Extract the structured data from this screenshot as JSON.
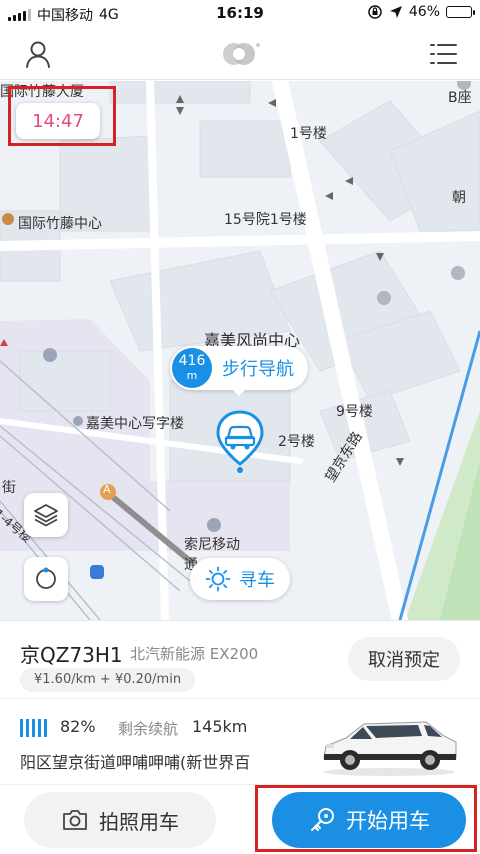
{
  "status_bar": {
    "carrier": "中国移动",
    "network": "4G",
    "time": "16:19",
    "battery": "46%",
    "battery_level": 0.46
  },
  "nav": {
    "user_icon": "user-icon",
    "logo_icon": "app-logo-icon",
    "menu_icon": "list-menu-icon"
  },
  "map": {
    "countdown": "14:47",
    "labels": {
      "top_cut": "国际竹藤大厦",
      "b_building": "B座",
      "building_1": "1号楼",
      "chao": "朝",
      "bamboo_center": "国际竹藤中心",
      "courtyard_15": "15号院1号楼",
      "jiamei_center": "嘉美风尚中心",
      "jiamei_office": "嘉美中心写字楼",
      "building_9": "9号楼",
      "building_2": "2号楼",
      "wangjing_road": "望京东路",
      "sony_mobile": "索尼移动",
      "sony_sub": "通",
      "street_cut": "街",
      "side_cut": "1-4号楼",
      "poi_a": "A"
    },
    "walk_nav": {
      "distance": "416",
      "unit": "m",
      "label": "步行导航"
    },
    "find_car": "寻车",
    "accent": "#1990e6"
  },
  "car": {
    "plate": "京QZ73H1",
    "model": "北汽新能源 EX200",
    "price": "¥1.60/km + ¥0.20/min",
    "cancel_label": "取消预定",
    "battery_pct": "82%",
    "range_label": "剩余续航",
    "range_value": "145km",
    "address": "阳区望京街道呷哺呷哺(新世界百"
  },
  "actions": {
    "photo_label": "拍照用车",
    "start_label": "开始用车",
    "start_color": "#1a8fe3"
  }
}
